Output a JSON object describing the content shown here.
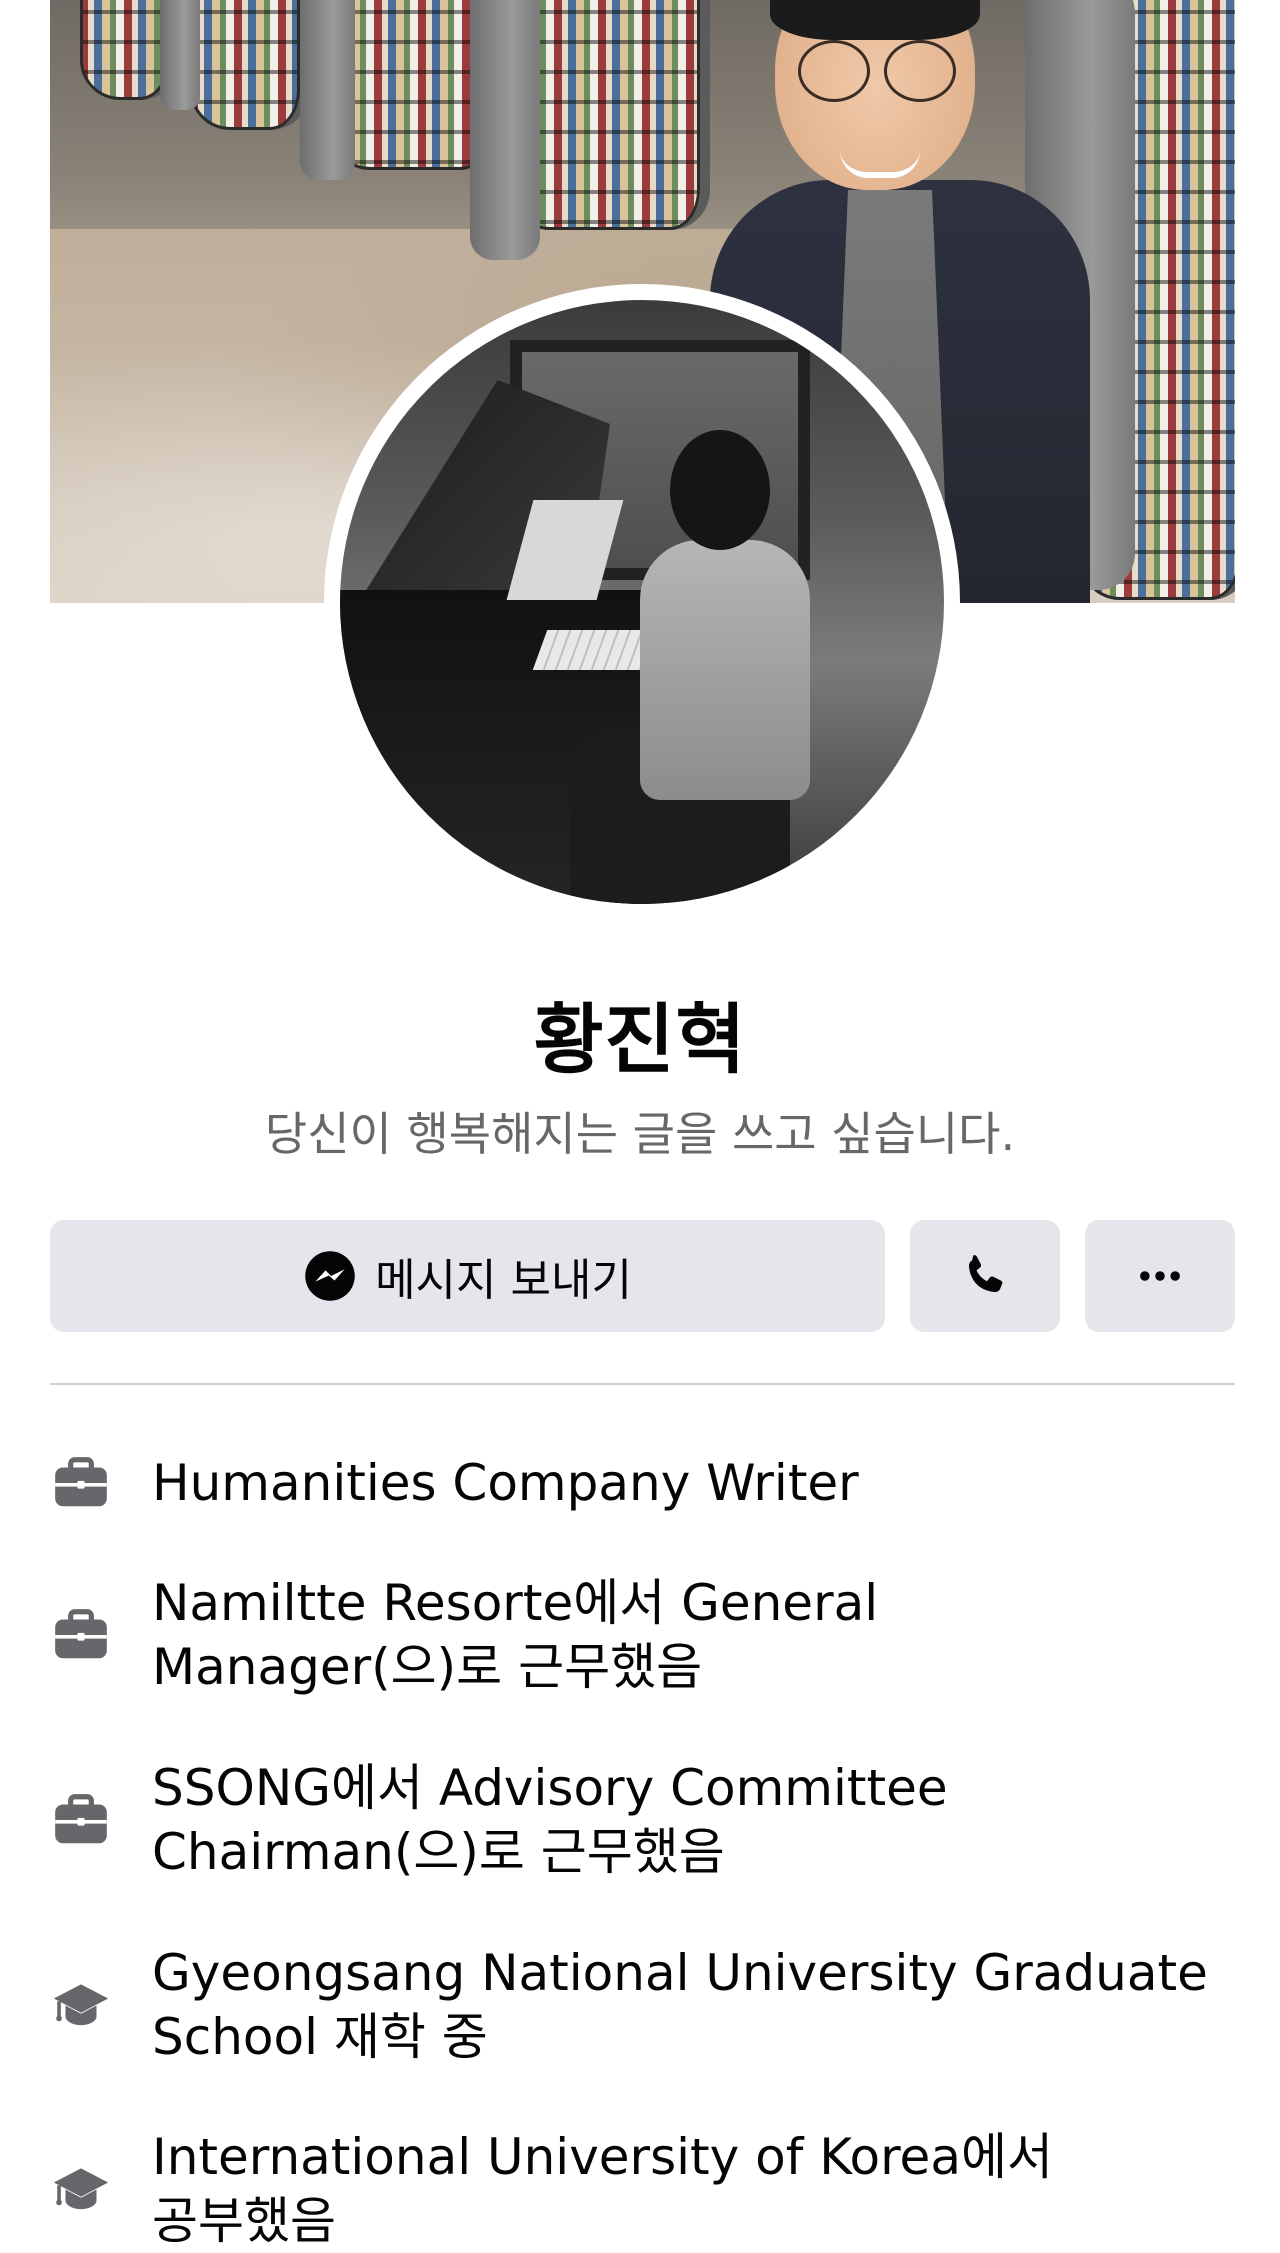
{
  "profile": {
    "name": "황진혁",
    "bio": "당신이 행복해지는 글을 쓰고 싶습니다."
  },
  "actions": {
    "message_label": "메시지 보내기",
    "message_icon": "messenger-icon",
    "call_icon": "phone-icon",
    "more_icon": "more-dots-icon"
  },
  "info": [
    {
      "icon": "briefcase-icon",
      "text": "Humanities Company Writer"
    },
    {
      "icon": "briefcase-icon",
      "text": "Namiltte Resorte에서 General\nManager(으)로 근무했음"
    },
    {
      "icon": "briefcase-icon",
      "text": "SSONG에서 Advisory Committee\nChairman(으)로 근무했음"
    },
    {
      "icon": "graduation-cap-icon",
      "text": "Gyeongsang National University Graduate\nSchool 재학 중"
    },
    {
      "icon": "graduation-cap-icon",
      "text": "International University of Korea에서\n공부했음"
    }
  ],
  "colors": {
    "button_bg": "#e4e6eb",
    "secondary_text": "#65676b",
    "icon_gray": "#65676b",
    "divider": "#ced0d4"
  }
}
